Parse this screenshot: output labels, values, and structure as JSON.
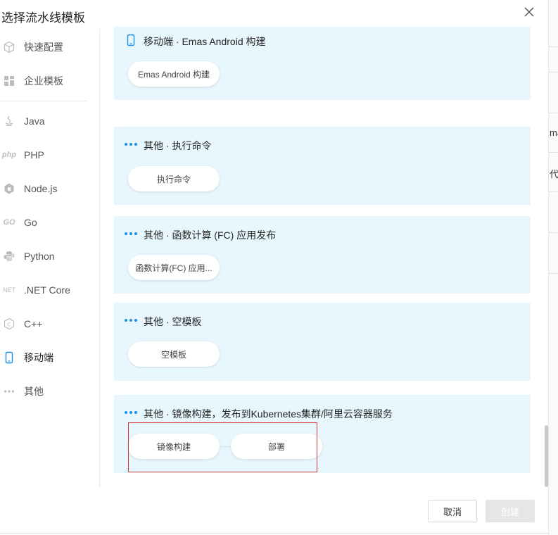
{
  "dialog": {
    "title": "选择流水线模板",
    "close_icon": "close-icon"
  },
  "background": {
    "fragments": [
      "ma",
      "代"
    ]
  },
  "sidebar": {
    "items": [
      {
        "label": "快速配置",
        "icon": "cube-icon"
      },
      {
        "label": "企业模板",
        "icon": "grid-icon"
      },
      {
        "label": "Java",
        "icon": "java-icon"
      },
      {
        "label": "PHP",
        "icon": "php-icon",
        "icon_text": "php"
      },
      {
        "label": "Node.js",
        "icon": "nodejs-icon"
      },
      {
        "label": "Go",
        "icon": "go-icon",
        "icon_text": "GO"
      },
      {
        "label": "Python",
        "icon": "python-icon"
      },
      {
        "label": ".NET Core",
        "icon": "dotnet-icon",
        "icon_text": "NET"
      },
      {
        "label": "C++",
        "icon": "cpp-icon",
        "icon_text": "C"
      },
      {
        "label": "移动端",
        "icon": "mobile-icon",
        "active": true
      },
      {
        "label": "其他",
        "icon": "more-icon"
      }
    ]
  },
  "templates": [
    {
      "title": "移动端 · Emas Android 构建",
      "icon": "mobile-icon",
      "stages": [
        "Emas Android 构建"
      ]
    },
    {
      "title": "其他 · 执行命令",
      "icon": "more-icon",
      "stages": [
        "执行命令"
      ]
    },
    {
      "title": "其他 · 函数计算 (FC) 应用发布",
      "icon": "more-icon",
      "stages": [
        "函数计算(FC) 应用..."
      ]
    },
    {
      "title": "其他 · 空模板",
      "icon": "more-icon",
      "stages": [
        "空模板"
      ]
    },
    {
      "title": "其他 · 镜像构建，发布到Kubernetes集群/阿里云容器服务",
      "icon": "more-icon",
      "stages": [
        "镜像构建",
        "部署"
      ]
    }
  ],
  "footer": {
    "cancel_label": "取消",
    "create_label": "创建"
  },
  "colors": {
    "accent": "#1b8fe6",
    "card_bg": "#e8f6fd",
    "highlight_border": "#d9363e",
    "disabled_button": "#e6e6e6"
  }
}
